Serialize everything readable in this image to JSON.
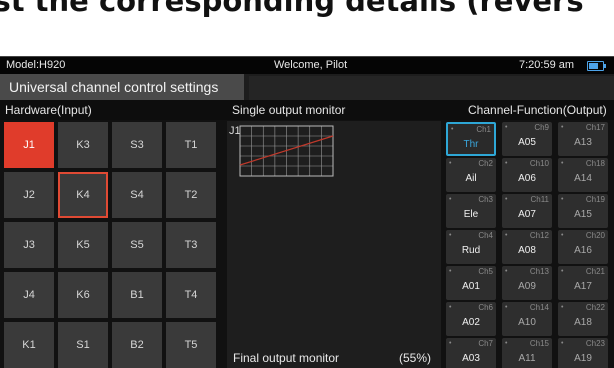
{
  "banner": {
    "text": "dit to adjust the corresponding details (revers"
  },
  "status": {
    "model": "Model:H920",
    "welcome": "Welcome, Pilot",
    "time": "7:20:59 am"
  },
  "title": "Universal channel control settings",
  "headers": {
    "hardware": "Hardware(Input)",
    "single": "Single output monitor",
    "channel": "Channel-Function(Output)"
  },
  "hardware": [
    {
      "label": "J1",
      "state": "active"
    },
    {
      "label": "K3",
      "state": ""
    },
    {
      "label": "S3",
      "state": ""
    },
    {
      "label": "T1",
      "state": ""
    },
    {
      "label": "J2",
      "state": ""
    },
    {
      "label": "K4",
      "state": "sel"
    },
    {
      "label": "S4",
      "state": ""
    },
    {
      "label": "T2",
      "state": ""
    },
    {
      "label": "J3",
      "state": ""
    },
    {
      "label": "K5",
      "state": ""
    },
    {
      "label": "S5",
      "state": ""
    },
    {
      "label": "T3",
      "state": ""
    },
    {
      "label": "J4",
      "state": ""
    },
    {
      "label": "K6",
      "state": ""
    },
    {
      "label": "B1",
      "state": ""
    },
    {
      "label": "T4",
      "state": ""
    },
    {
      "label": "K1",
      "state": ""
    },
    {
      "label": "S1",
      "state": ""
    },
    {
      "label": "B2",
      "state": ""
    },
    {
      "label": "T5",
      "state": ""
    }
  ],
  "monitor": {
    "channel": "J1",
    "final_label": "Final output monitor",
    "percent": "(55%)",
    "line_color": "#c0392b"
  },
  "channels": [
    {
      "num": "Ch1",
      "func": "Thr",
      "active": true
    },
    {
      "num": "Ch9",
      "func": "A05"
    },
    {
      "num": "Ch17",
      "func": "A13",
      "dim": true
    },
    {
      "num": "Ch2",
      "func": "Ail"
    },
    {
      "num": "Ch10",
      "func": "A06"
    },
    {
      "num": "Ch18",
      "func": "A14",
      "dim": true
    },
    {
      "num": "Ch3",
      "func": "Ele"
    },
    {
      "num": "Ch11",
      "func": "A07"
    },
    {
      "num": "Ch19",
      "func": "A15",
      "dim": true
    },
    {
      "num": "Ch4",
      "func": "Rud"
    },
    {
      "num": "Ch12",
      "func": "A08"
    },
    {
      "num": "Ch20",
      "func": "A16",
      "dim": true
    },
    {
      "num": "Ch5",
      "func": "A01"
    },
    {
      "num": "Ch13",
      "func": "A09",
      "dim": true
    },
    {
      "num": "Ch21",
      "func": "A17",
      "dim": true
    },
    {
      "num": "Ch6",
      "func": "A02"
    },
    {
      "num": "Ch14",
      "func": "A10",
      "dim": true
    },
    {
      "num": "Ch22",
      "func": "A18",
      "dim": true
    },
    {
      "num": "Ch7",
      "func": "A03"
    },
    {
      "num": "Ch15",
      "func": "A11",
      "dim": true
    },
    {
      "num": "Ch23",
      "func": "A19",
      "dim": true
    }
  ],
  "colors": {
    "accent_red": "#e03c2b",
    "accent_blue": "#2ea7d6",
    "battery": "#4da3e8"
  }
}
